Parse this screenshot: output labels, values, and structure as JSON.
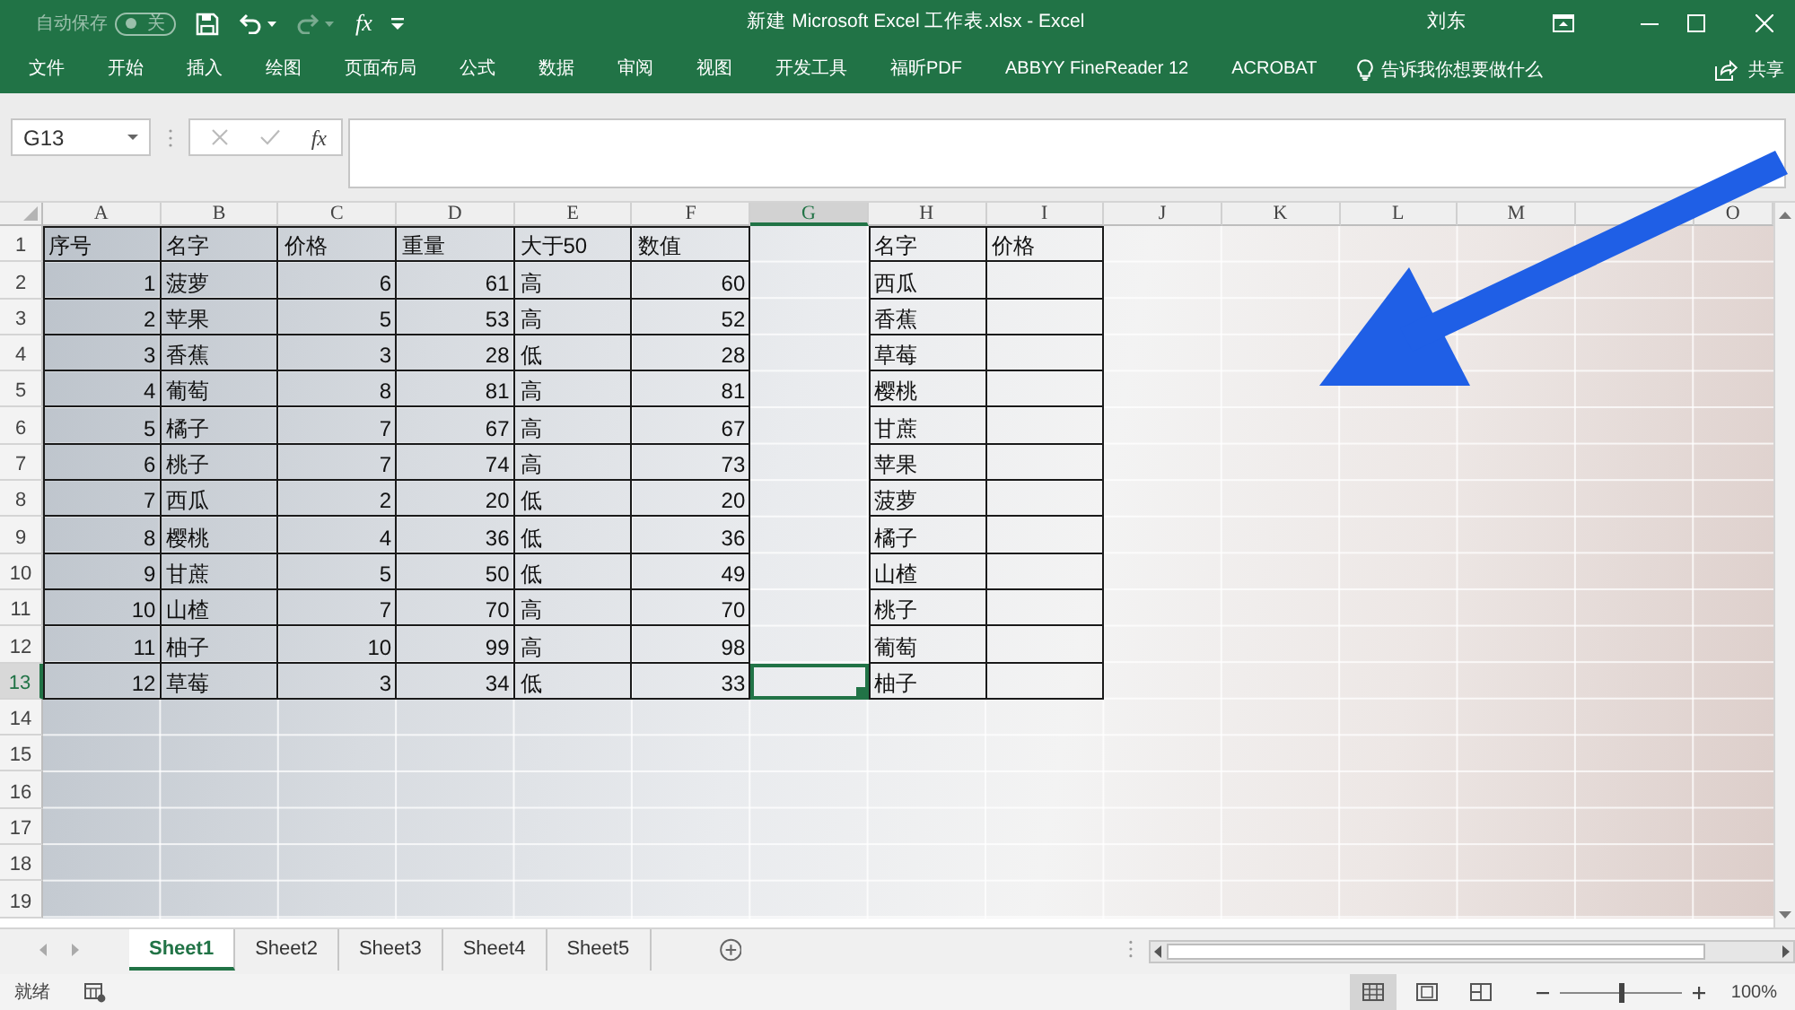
{
  "title_bar": {
    "autosave": {
      "label": "自动保存",
      "state_text": "关",
      "on": false
    },
    "redo_disabled": true,
    "function_button": "fx",
    "title": "新建 Microsoft Excel 工作表.xlsx - Excel",
    "user": "刘东"
  },
  "ribbon_tabs": [
    {
      "label": "文件",
      "selected": false
    },
    {
      "label": "开始",
      "selected": false
    },
    {
      "label": "插入",
      "selected": false
    },
    {
      "label": "绘图",
      "selected": false
    },
    {
      "label": "页面布局",
      "selected": false
    },
    {
      "label": "公式",
      "selected": false
    },
    {
      "label": "数据",
      "selected": false
    },
    {
      "label": "审阅",
      "selected": false
    },
    {
      "label": "视图",
      "selected": false
    },
    {
      "label": "开发工具",
      "selected": false
    },
    {
      "label": "福昕PDF",
      "selected": false
    },
    {
      "label": "ABBYY FineReader 12",
      "selected": false
    },
    {
      "label": "ACROBAT",
      "selected": false
    }
  ],
  "tell_me": "告诉我你想要做什么",
  "share": "共享",
  "formula_bar": {
    "name_box": "G13",
    "edit_disabled": true,
    "function_button": "fx"
  },
  "sheet": {
    "columns": [
      {
        "label": "A",
        "selected": false
      },
      {
        "label": "B",
        "selected": false
      },
      {
        "label": "C",
        "selected": false
      },
      {
        "label": "D",
        "selected": false
      },
      {
        "label": "E",
        "selected": false
      },
      {
        "label": "F",
        "selected": false
      },
      {
        "label": "G",
        "selected": true
      },
      {
        "label": "H",
        "selected": false
      },
      {
        "label": "I",
        "selected": false
      },
      {
        "label": "J",
        "selected": false
      },
      {
        "label": "K",
        "selected": false
      },
      {
        "label": "L",
        "selected": false
      },
      {
        "label": "M",
        "selected": false
      },
      {
        "selected": false
      },
      {
        "label": "O",
        "selected": false
      }
    ],
    "rows": [
      {
        "header": "1",
        "selected": false,
        "cells": [
          {
            "text": "序号",
            "kind": "text"
          },
          {
            "text": "名字",
            "kind": "text"
          },
          {
            "text": "价格",
            "kind": "text"
          },
          {
            "text": "重量",
            "kind": "text"
          },
          {
            "text": "大于50",
            "kind": "text"
          },
          {
            "text": "数值",
            "kind": "text"
          },
          null,
          {
            "text": "名字",
            "kind": "text"
          },
          {
            "text": "价格",
            "kind": "text"
          }
        ]
      },
      {
        "header": "2",
        "selected": false,
        "cells": [
          {
            "text": "1",
            "kind": "number"
          },
          {
            "text": "菠萝",
            "kind": "text"
          },
          {
            "text": "6",
            "kind": "number"
          },
          {
            "text": "61",
            "kind": "number"
          },
          {
            "text": "高",
            "kind": "text"
          },
          {
            "text": "60",
            "kind": "number"
          },
          null,
          {
            "text": "西瓜",
            "kind": "text"
          },
          {
            "kind": "blank"
          }
        ]
      },
      {
        "header": "3",
        "selected": false,
        "cells": [
          {
            "text": "2",
            "kind": "number"
          },
          {
            "text": "苹果",
            "kind": "text"
          },
          {
            "text": "5",
            "kind": "number"
          },
          {
            "text": "53",
            "kind": "number"
          },
          {
            "text": "高",
            "kind": "text"
          },
          {
            "text": "52",
            "kind": "number"
          },
          null,
          {
            "text": "香蕉",
            "kind": "text"
          },
          {
            "kind": "blank"
          }
        ]
      },
      {
        "header": "4",
        "selected": false,
        "cells": [
          {
            "text": "3",
            "kind": "number"
          },
          {
            "text": "香蕉",
            "kind": "text"
          },
          {
            "text": "3",
            "kind": "number"
          },
          {
            "text": "28",
            "kind": "number"
          },
          {
            "text": "低",
            "kind": "text"
          },
          {
            "text": "28",
            "kind": "number"
          },
          null,
          {
            "text": "草莓",
            "kind": "text"
          },
          {
            "kind": "blank"
          }
        ]
      },
      {
        "header": "5",
        "selected": false,
        "cells": [
          {
            "text": "4",
            "kind": "number"
          },
          {
            "text": "葡萄",
            "kind": "text"
          },
          {
            "text": "8",
            "kind": "number"
          },
          {
            "text": "81",
            "kind": "number"
          },
          {
            "text": "高",
            "kind": "text"
          },
          {
            "text": "81",
            "kind": "number"
          },
          null,
          {
            "text": "樱桃",
            "kind": "text"
          },
          {
            "kind": "blank"
          }
        ]
      },
      {
        "header": "6",
        "selected": false,
        "cells": [
          {
            "text": "5",
            "kind": "number"
          },
          {
            "text": "橘子",
            "kind": "text"
          },
          {
            "text": "7",
            "kind": "number"
          },
          {
            "text": "67",
            "kind": "number"
          },
          {
            "text": "高",
            "kind": "text"
          },
          {
            "text": "67",
            "kind": "number"
          },
          null,
          {
            "text": "甘蔗",
            "kind": "text"
          },
          {
            "kind": "blank"
          }
        ]
      },
      {
        "header": "7",
        "selected": false,
        "cells": [
          {
            "text": "6",
            "kind": "number"
          },
          {
            "text": "桃子",
            "kind": "text"
          },
          {
            "text": "7",
            "kind": "number"
          },
          {
            "text": "74",
            "kind": "number"
          },
          {
            "text": "高",
            "kind": "text"
          },
          {
            "text": "73",
            "kind": "number"
          },
          null,
          {
            "text": "苹果",
            "kind": "text"
          },
          {
            "kind": "blank"
          }
        ]
      },
      {
        "header": "8",
        "selected": false,
        "cells": [
          {
            "text": "7",
            "kind": "number"
          },
          {
            "text": "西瓜",
            "kind": "text"
          },
          {
            "text": "2",
            "kind": "number"
          },
          {
            "text": "20",
            "kind": "number"
          },
          {
            "text": "低",
            "kind": "text"
          },
          {
            "text": "20",
            "kind": "number"
          },
          null,
          {
            "text": "菠萝",
            "kind": "text"
          },
          {
            "kind": "blank"
          }
        ]
      },
      {
        "header": "9",
        "selected": false,
        "cells": [
          {
            "text": "8",
            "kind": "number"
          },
          {
            "text": "樱桃",
            "kind": "text"
          },
          {
            "text": "4",
            "kind": "number"
          },
          {
            "text": "36",
            "kind": "number"
          },
          {
            "text": "低",
            "kind": "text"
          },
          {
            "text": "36",
            "kind": "number"
          },
          null,
          {
            "text": "橘子",
            "kind": "text"
          },
          {
            "kind": "blank"
          }
        ]
      },
      {
        "header": "10",
        "selected": false,
        "cells": [
          {
            "text": "9",
            "kind": "number"
          },
          {
            "text": "甘蔗",
            "kind": "text"
          },
          {
            "text": "5",
            "kind": "number"
          },
          {
            "text": "50",
            "kind": "number"
          },
          {
            "text": "低",
            "kind": "text"
          },
          {
            "text": "49",
            "kind": "number"
          },
          null,
          {
            "text": "山楂",
            "kind": "text"
          },
          {
            "kind": "blank"
          }
        ]
      },
      {
        "header": "11",
        "selected": false,
        "cells": [
          {
            "text": "10",
            "kind": "number"
          },
          {
            "text": "山楂",
            "kind": "text"
          },
          {
            "text": "7",
            "kind": "number"
          },
          {
            "text": "70",
            "kind": "number"
          },
          {
            "text": "高",
            "kind": "text"
          },
          {
            "text": "70",
            "kind": "number"
          },
          null,
          {
            "text": "桃子",
            "kind": "text"
          },
          {
            "kind": "blank"
          }
        ]
      },
      {
        "header": "12",
        "selected": false,
        "cells": [
          {
            "text": "11",
            "kind": "number"
          },
          {
            "text": "柚子",
            "kind": "text"
          },
          {
            "text": "10",
            "kind": "number"
          },
          {
            "text": "99",
            "kind": "number"
          },
          {
            "text": "高",
            "kind": "text"
          },
          {
            "text": "98",
            "kind": "number"
          },
          null,
          {
            "text": "葡萄",
            "kind": "text"
          },
          {
            "kind": "blank"
          }
        ]
      },
      {
        "header": "13",
        "selected": true,
        "cells": [
          {
            "text": "12",
            "kind": "number"
          },
          {
            "text": "草莓",
            "kind": "text"
          },
          {
            "text": "3",
            "kind": "number"
          },
          {
            "text": "34",
            "kind": "number"
          },
          {
            "text": "低",
            "kind": "text"
          },
          {
            "text": "33",
            "kind": "number"
          },
          null,
          {
            "text": "柚子",
            "kind": "text"
          },
          {
            "kind": "blank"
          }
        ]
      },
      {
        "header": "14",
        "selected": false
      },
      {
        "header": "15",
        "selected": false
      },
      {
        "header": "16",
        "selected": false
      },
      {
        "header": "17",
        "selected": false
      },
      {
        "header": "18",
        "selected": false
      },
      {
        "header": "19",
        "selected": false
      }
    ]
  },
  "sheet_tabs": [
    {
      "label": "Sheet1",
      "selected": true
    },
    {
      "label": "Sheet2",
      "selected": false
    },
    {
      "label": "Sheet3",
      "selected": false
    },
    {
      "label": "Sheet4",
      "selected": false
    },
    {
      "label": "Sheet5",
      "selected": false
    }
  ],
  "status_bar": {
    "status": "就绪",
    "views": [
      {
        "kind": "normal",
        "selected": true
      },
      {
        "kind": "page_layout",
        "selected": false
      },
      {
        "kind": "page_break",
        "selected": false
      }
    ],
    "zoom": {
      "level": 0.5,
      "reading": "100%"
    }
  }
}
